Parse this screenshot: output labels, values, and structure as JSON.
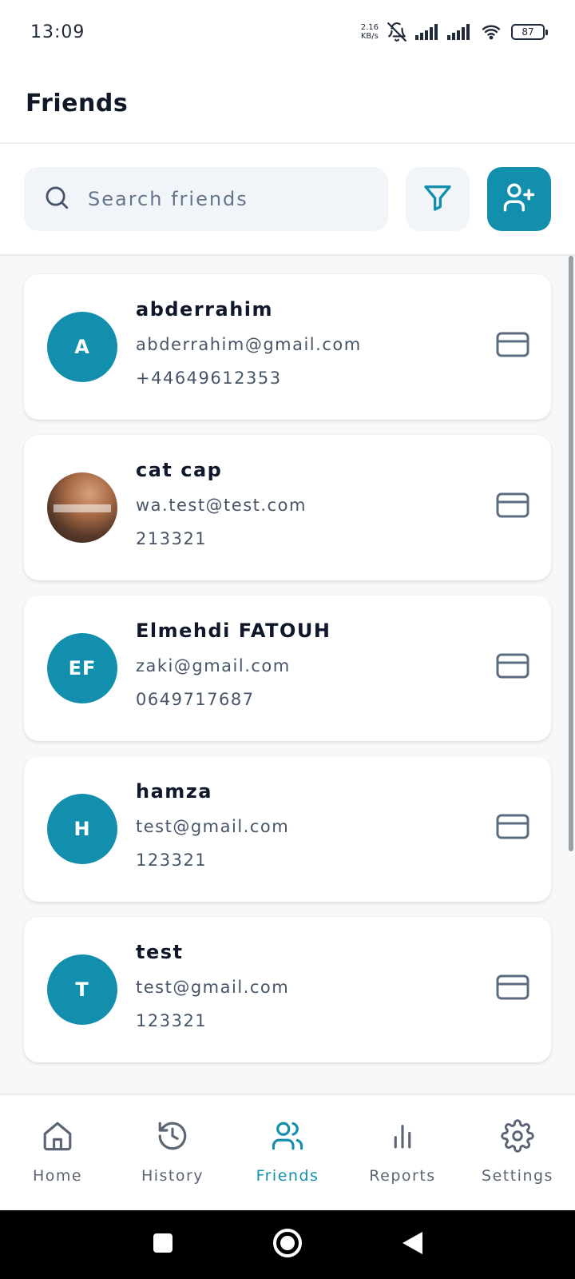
{
  "status_bar": {
    "time": "13:09",
    "net_speed_value": "2.16",
    "net_speed_unit": "KB/s",
    "battery": "87",
    "icons": [
      "bell-muted-icon",
      "signal-icon",
      "signal-icon",
      "wifi-icon",
      "battery-icon"
    ]
  },
  "header": {
    "title": "Friends"
  },
  "search": {
    "placeholder": "Search friends",
    "value": ""
  },
  "actions": {
    "filter_icon": "filter-icon",
    "add_icon": "user-plus-icon"
  },
  "colors": {
    "accent": "#138fae",
    "text_dark": "#0f172a",
    "text_muted": "#475569",
    "list_bg": "#f7f8fa"
  },
  "friends": [
    {
      "initials": "A",
      "avatar_type": "initials",
      "name": "abderrahim",
      "email": "abderrahim@gmail.com",
      "phone": "+44649612353",
      "action_icon": "card-icon"
    },
    {
      "initials": "",
      "avatar_type": "photo",
      "name": "cat cap",
      "email": "wa.test@test.com",
      "phone": "213321",
      "action_icon": "card-icon"
    },
    {
      "initials": "EF",
      "avatar_type": "initials",
      "name": "Elmehdi FATOUH",
      "email": "zaki@gmail.com",
      "phone": "0649717687",
      "action_icon": "card-icon"
    },
    {
      "initials": "H",
      "avatar_type": "initials",
      "name": "hamza",
      "email": "test@gmail.com",
      "phone": "123321",
      "action_icon": "card-icon"
    },
    {
      "initials": "T",
      "avatar_type": "initials",
      "name": "test",
      "email": "test@gmail.com",
      "phone": "123321",
      "action_icon": "card-icon"
    }
  ],
  "nav": {
    "active": "Friends",
    "items": [
      {
        "label": "Home",
        "icon": "home-icon"
      },
      {
        "label": "History",
        "icon": "history-icon"
      },
      {
        "label": "Friends",
        "icon": "users-icon"
      },
      {
        "label": "Reports",
        "icon": "bar-chart-icon"
      },
      {
        "label": "Settings",
        "icon": "gear-icon"
      }
    ]
  },
  "system_nav": {
    "icons": [
      "recents-icon",
      "home-circle-icon",
      "back-icon"
    ]
  }
}
